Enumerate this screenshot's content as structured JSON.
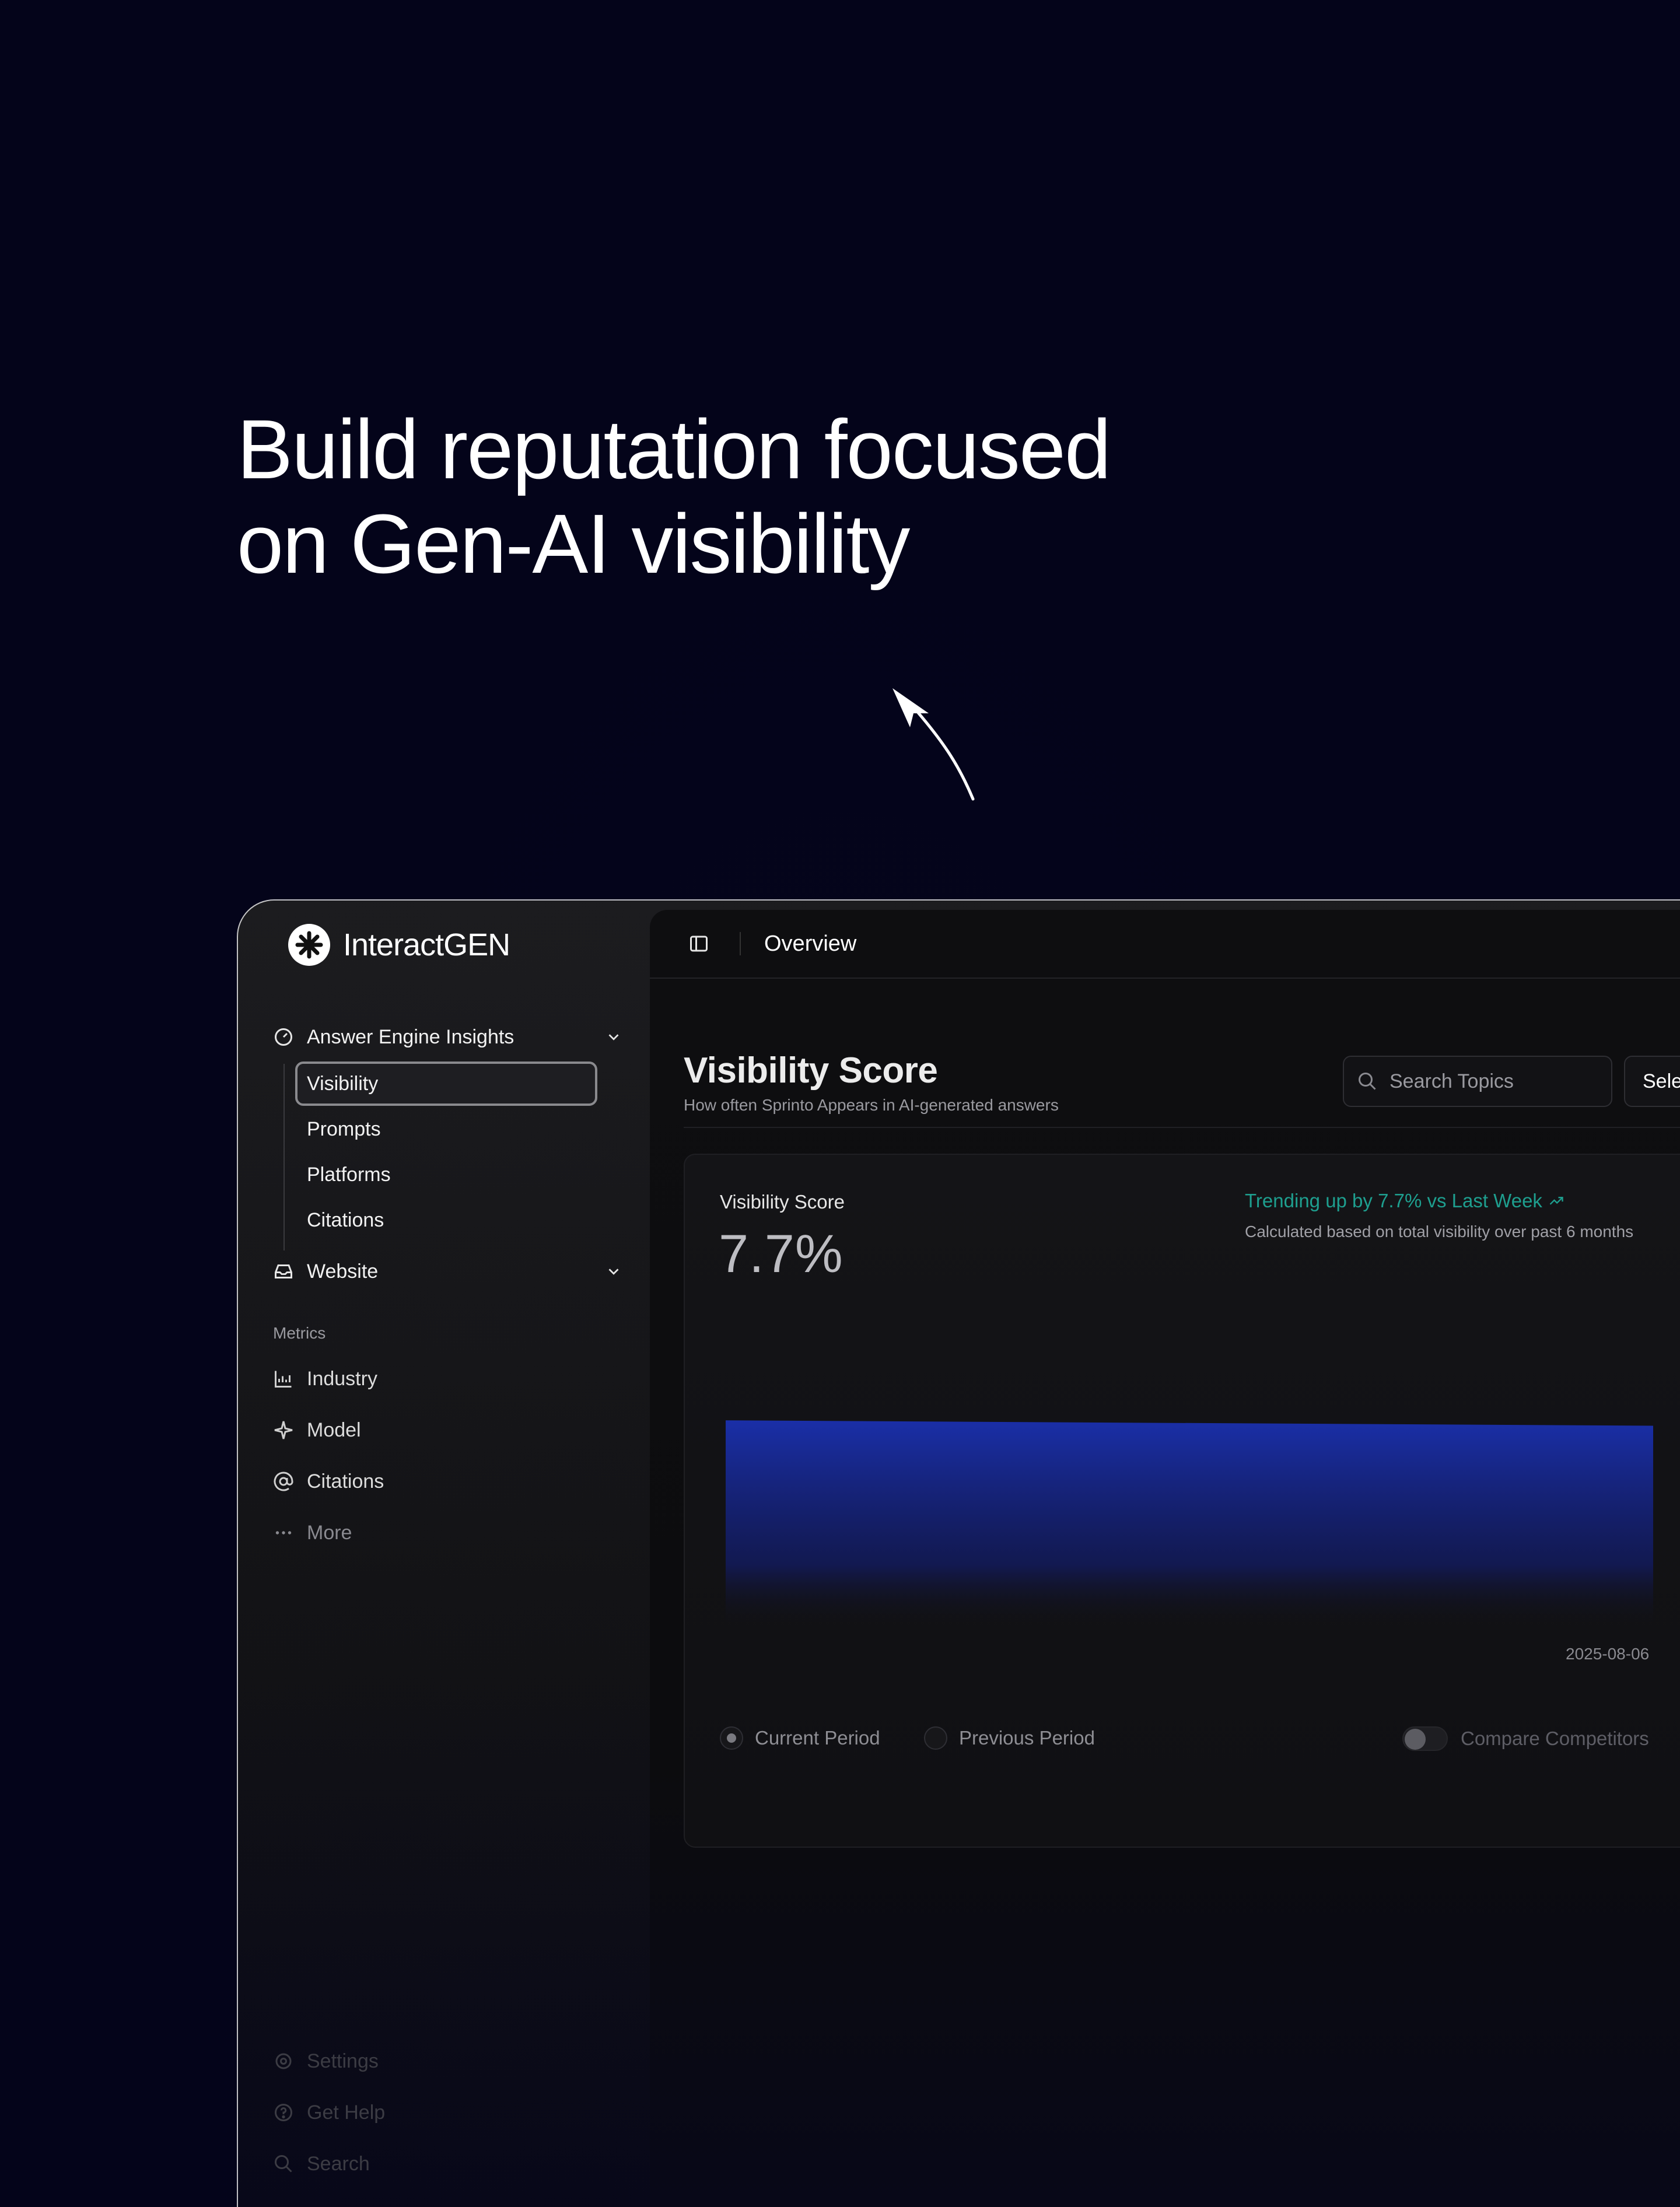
{
  "hero": {
    "title_line1": "Build reputation focused",
    "title_line2": "on Gen-AI visibility"
  },
  "app": {
    "brand": "InteractGEN",
    "sidebar": {
      "group_answer_engine": "Answer Engine Insights",
      "sub_items": [
        "Visibility",
        "Prompts",
        "Platforms",
        "Citations"
      ],
      "active_item": "Visibility",
      "group_website": "Website",
      "metrics_label": "Metrics",
      "metrics": [
        {
          "label": "Industry",
          "icon": "chart-icon"
        },
        {
          "label": "Model",
          "icon": "sparkle-icon"
        },
        {
          "label": "Citations",
          "icon": "at-sign-icon"
        },
        {
          "label": "More",
          "icon": "more-icon"
        }
      ],
      "footer": [
        "Settings",
        "Get Help",
        "Search"
      ]
    },
    "topbar": {
      "title": "Overview"
    },
    "main": {
      "heading": "Visibility Score",
      "subheading": "How often Sprinto Appears in AI-generated answers",
      "search_placeholder": "Search Topics",
      "select_label": "Sele"
    },
    "card": {
      "label": "Visibility Score",
      "value": "7.7%",
      "trend": "Trending up by 7.7% vs Last Week",
      "calc_note": "Calculated based on total visibility over past 6 months",
      "date_tick": "2025-08-06",
      "legend_current": "Current Period",
      "legend_previous": "Previous Period",
      "compare_label": "Compare Competitors",
      "accent": "#1e9f8f",
      "area_color": "#1a2fa8"
    }
  },
  "chart_data": {
    "type": "area",
    "x": [
      "",
      "2025-08-06"
    ],
    "series": [
      {
        "values": [
          7.7,
          7.5
        ]
      }
    ],
    "xlabel": "",
    "ylabel": "",
    "grid": false
  }
}
